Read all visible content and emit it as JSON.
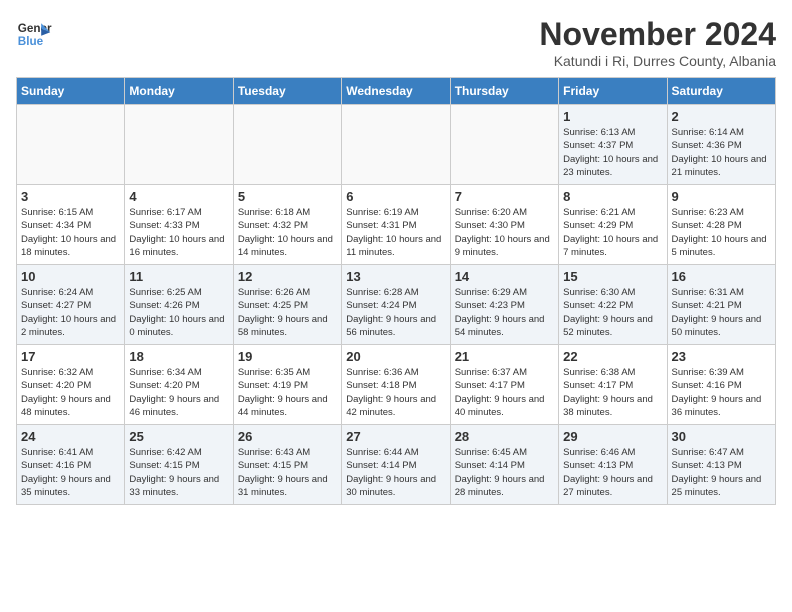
{
  "logo": {
    "line1": "General",
    "line2": "Blue"
  },
  "title": "November 2024",
  "location": "Katundi i Ri, Durres County, Albania",
  "headers": [
    "Sunday",
    "Monday",
    "Tuesday",
    "Wednesday",
    "Thursday",
    "Friday",
    "Saturday"
  ],
  "weeks": [
    [
      {
        "day": "",
        "info": ""
      },
      {
        "day": "",
        "info": ""
      },
      {
        "day": "",
        "info": ""
      },
      {
        "day": "",
        "info": ""
      },
      {
        "day": "",
        "info": ""
      },
      {
        "day": "1",
        "info": "Sunrise: 6:13 AM\nSunset: 4:37 PM\nDaylight: 10 hours\nand 23 minutes."
      },
      {
        "day": "2",
        "info": "Sunrise: 6:14 AM\nSunset: 4:36 PM\nDaylight: 10 hours\nand 21 minutes."
      }
    ],
    [
      {
        "day": "3",
        "info": "Sunrise: 6:15 AM\nSunset: 4:34 PM\nDaylight: 10 hours\nand 18 minutes."
      },
      {
        "day": "4",
        "info": "Sunrise: 6:17 AM\nSunset: 4:33 PM\nDaylight: 10 hours\nand 16 minutes."
      },
      {
        "day": "5",
        "info": "Sunrise: 6:18 AM\nSunset: 4:32 PM\nDaylight: 10 hours\nand 14 minutes."
      },
      {
        "day": "6",
        "info": "Sunrise: 6:19 AM\nSunset: 4:31 PM\nDaylight: 10 hours\nand 11 minutes."
      },
      {
        "day": "7",
        "info": "Sunrise: 6:20 AM\nSunset: 4:30 PM\nDaylight: 10 hours\nand 9 minutes."
      },
      {
        "day": "8",
        "info": "Sunrise: 6:21 AM\nSunset: 4:29 PM\nDaylight: 10 hours\nand 7 minutes."
      },
      {
        "day": "9",
        "info": "Sunrise: 6:23 AM\nSunset: 4:28 PM\nDaylight: 10 hours\nand 5 minutes."
      }
    ],
    [
      {
        "day": "10",
        "info": "Sunrise: 6:24 AM\nSunset: 4:27 PM\nDaylight: 10 hours\nand 2 minutes."
      },
      {
        "day": "11",
        "info": "Sunrise: 6:25 AM\nSunset: 4:26 PM\nDaylight: 10 hours\nand 0 minutes."
      },
      {
        "day": "12",
        "info": "Sunrise: 6:26 AM\nSunset: 4:25 PM\nDaylight: 9 hours\nand 58 minutes."
      },
      {
        "day": "13",
        "info": "Sunrise: 6:28 AM\nSunset: 4:24 PM\nDaylight: 9 hours\nand 56 minutes."
      },
      {
        "day": "14",
        "info": "Sunrise: 6:29 AM\nSunset: 4:23 PM\nDaylight: 9 hours\nand 54 minutes."
      },
      {
        "day": "15",
        "info": "Sunrise: 6:30 AM\nSunset: 4:22 PM\nDaylight: 9 hours\nand 52 minutes."
      },
      {
        "day": "16",
        "info": "Sunrise: 6:31 AM\nSunset: 4:21 PM\nDaylight: 9 hours\nand 50 minutes."
      }
    ],
    [
      {
        "day": "17",
        "info": "Sunrise: 6:32 AM\nSunset: 4:20 PM\nDaylight: 9 hours\nand 48 minutes."
      },
      {
        "day": "18",
        "info": "Sunrise: 6:34 AM\nSunset: 4:20 PM\nDaylight: 9 hours\nand 46 minutes."
      },
      {
        "day": "19",
        "info": "Sunrise: 6:35 AM\nSunset: 4:19 PM\nDaylight: 9 hours\nand 44 minutes."
      },
      {
        "day": "20",
        "info": "Sunrise: 6:36 AM\nSunset: 4:18 PM\nDaylight: 9 hours\nand 42 minutes."
      },
      {
        "day": "21",
        "info": "Sunrise: 6:37 AM\nSunset: 4:17 PM\nDaylight: 9 hours\nand 40 minutes."
      },
      {
        "day": "22",
        "info": "Sunrise: 6:38 AM\nSunset: 4:17 PM\nDaylight: 9 hours\nand 38 minutes."
      },
      {
        "day": "23",
        "info": "Sunrise: 6:39 AM\nSunset: 4:16 PM\nDaylight: 9 hours\nand 36 minutes."
      }
    ],
    [
      {
        "day": "24",
        "info": "Sunrise: 6:41 AM\nSunset: 4:16 PM\nDaylight: 9 hours\nand 35 minutes."
      },
      {
        "day": "25",
        "info": "Sunrise: 6:42 AM\nSunset: 4:15 PM\nDaylight: 9 hours\nand 33 minutes."
      },
      {
        "day": "26",
        "info": "Sunrise: 6:43 AM\nSunset: 4:15 PM\nDaylight: 9 hours\nand 31 minutes."
      },
      {
        "day": "27",
        "info": "Sunrise: 6:44 AM\nSunset: 4:14 PM\nDaylight: 9 hours\nand 30 minutes."
      },
      {
        "day": "28",
        "info": "Sunrise: 6:45 AM\nSunset: 4:14 PM\nDaylight: 9 hours\nand 28 minutes."
      },
      {
        "day": "29",
        "info": "Sunrise: 6:46 AM\nSunset: 4:13 PM\nDaylight: 9 hours\nand 27 minutes."
      },
      {
        "day": "30",
        "info": "Sunrise: 6:47 AM\nSunset: 4:13 PM\nDaylight: 9 hours\nand 25 minutes."
      }
    ]
  ]
}
